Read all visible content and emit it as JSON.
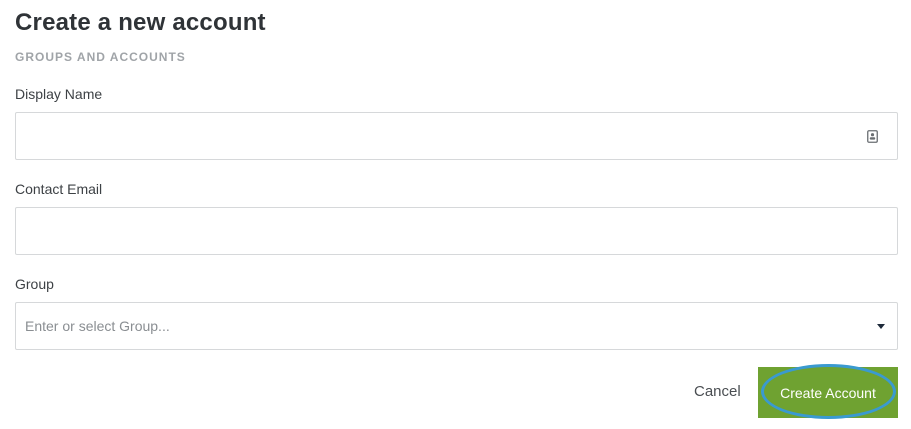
{
  "page": {
    "title": "Create a new account",
    "breadcrumb": "GROUPS AND ACCOUNTS"
  },
  "form": {
    "display_name": {
      "label": "Display Name",
      "value": "",
      "placeholder": ""
    },
    "contact_email": {
      "label": "Contact Email",
      "value": "",
      "placeholder": ""
    },
    "group": {
      "label": "Group",
      "value": "",
      "placeholder": "Enter or select Group..."
    }
  },
  "actions": {
    "cancel_label": "Cancel",
    "create_label": "Create Account"
  },
  "icons": {
    "display_name_icon": "contact-card-icon",
    "group_dropdown_icon": "caret-down-icon"
  },
  "colors": {
    "primary_button": "#6fa231",
    "focus_ring": "#3a9ad0",
    "field_border": "#d6d8da"
  }
}
